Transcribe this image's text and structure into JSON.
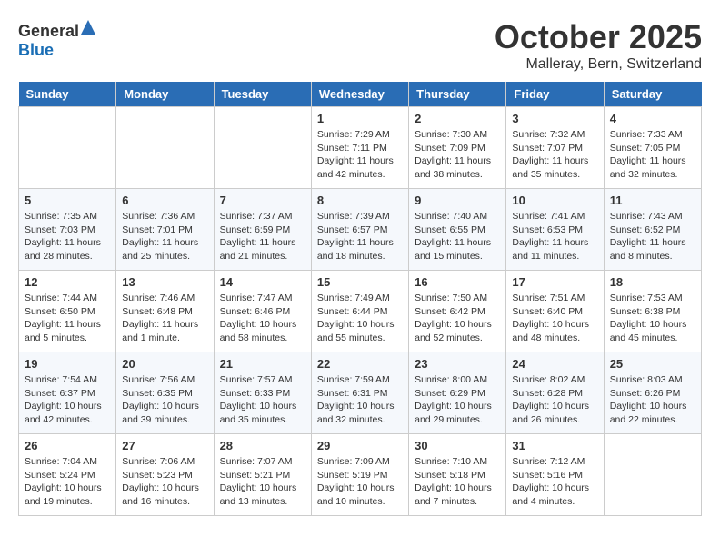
{
  "header": {
    "logo_general": "General",
    "logo_blue": "Blue",
    "month": "October 2025",
    "location": "Malleray, Bern, Switzerland"
  },
  "days_of_week": [
    "Sunday",
    "Monday",
    "Tuesday",
    "Wednesday",
    "Thursday",
    "Friday",
    "Saturday"
  ],
  "weeks": [
    [
      {
        "day": "",
        "info": ""
      },
      {
        "day": "",
        "info": ""
      },
      {
        "day": "",
        "info": ""
      },
      {
        "day": "1",
        "info": "Sunrise: 7:29 AM\nSunset: 7:11 PM\nDaylight: 11 hours\nand 42 minutes."
      },
      {
        "day": "2",
        "info": "Sunrise: 7:30 AM\nSunset: 7:09 PM\nDaylight: 11 hours\nand 38 minutes."
      },
      {
        "day": "3",
        "info": "Sunrise: 7:32 AM\nSunset: 7:07 PM\nDaylight: 11 hours\nand 35 minutes."
      },
      {
        "day": "4",
        "info": "Sunrise: 7:33 AM\nSunset: 7:05 PM\nDaylight: 11 hours\nand 32 minutes."
      }
    ],
    [
      {
        "day": "5",
        "info": "Sunrise: 7:35 AM\nSunset: 7:03 PM\nDaylight: 11 hours\nand 28 minutes."
      },
      {
        "day": "6",
        "info": "Sunrise: 7:36 AM\nSunset: 7:01 PM\nDaylight: 11 hours\nand 25 minutes."
      },
      {
        "day": "7",
        "info": "Sunrise: 7:37 AM\nSunset: 6:59 PM\nDaylight: 11 hours\nand 21 minutes."
      },
      {
        "day": "8",
        "info": "Sunrise: 7:39 AM\nSunset: 6:57 PM\nDaylight: 11 hours\nand 18 minutes."
      },
      {
        "day": "9",
        "info": "Sunrise: 7:40 AM\nSunset: 6:55 PM\nDaylight: 11 hours\nand 15 minutes."
      },
      {
        "day": "10",
        "info": "Sunrise: 7:41 AM\nSunset: 6:53 PM\nDaylight: 11 hours\nand 11 minutes."
      },
      {
        "day": "11",
        "info": "Sunrise: 7:43 AM\nSunset: 6:52 PM\nDaylight: 11 hours\nand 8 minutes."
      }
    ],
    [
      {
        "day": "12",
        "info": "Sunrise: 7:44 AM\nSunset: 6:50 PM\nDaylight: 11 hours\nand 5 minutes."
      },
      {
        "day": "13",
        "info": "Sunrise: 7:46 AM\nSunset: 6:48 PM\nDaylight: 11 hours\nand 1 minute."
      },
      {
        "day": "14",
        "info": "Sunrise: 7:47 AM\nSunset: 6:46 PM\nDaylight: 10 hours\nand 58 minutes."
      },
      {
        "day": "15",
        "info": "Sunrise: 7:49 AM\nSunset: 6:44 PM\nDaylight: 10 hours\nand 55 minutes."
      },
      {
        "day": "16",
        "info": "Sunrise: 7:50 AM\nSunset: 6:42 PM\nDaylight: 10 hours\nand 52 minutes."
      },
      {
        "day": "17",
        "info": "Sunrise: 7:51 AM\nSunset: 6:40 PM\nDaylight: 10 hours\nand 48 minutes."
      },
      {
        "day": "18",
        "info": "Sunrise: 7:53 AM\nSunset: 6:38 PM\nDaylight: 10 hours\nand 45 minutes."
      }
    ],
    [
      {
        "day": "19",
        "info": "Sunrise: 7:54 AM\nSunset: 6:37 PM\nDaylight: 10 hours\nand 42 minutes."
      },
      {
        "day": "20",
        "info": "Sunrise: 7:56 AM\nSunset: 6:35 PM\nDaylight: 10 hours\nand 39 minutes."
      },
      {
        "day": "21",
        "info": "Sunrise: 7:57 AM\nSunset: 6:33 PM\nDaylight: 10 hours\nand 35 minutes."
      },
      {
        "day": "22",
        "info": "Sunrise: 7:59 AM\nSunset: 6:31 PM\nDaylight: 10 hours\nand 32 minutes."
      },
      {
        "day": "23",
        "info": "Sunrise: 8:00 AM\nSunset: 6:29 PM\nDaylight: 10 hours\nand 29 minutes."
      },
      {
        "day": "24",
        "info": "Sunrise: 8:02 AM\nSunset: 6:28 PM\nDaylight: 10 hours\nand 26 minutes."
      },
      {
        "day": "25",
        "info": "Sunrise: 8:03 AM\nSunset: 6:26 PM\nDaylight: 10 hours\nand 22 minutes."
      }
    ],
    [
      {
        "day": "26",
        "info": "Sunrise: 7:04 AM\nSunset: 5:24 PM\nDaylight: 10 hours\nand 19 minutes."
      },
      {
        "day": "27",
        "info": "Sunrise: 7:06 AM\nSunset: 5:23 PM\nDaylight: 10 hours\nand 16 minutes."
      },
      {
        "day": "28",
        "info": "Sunrise: 7:07 AM\nSunset: 5:21 PM\nDaylight: 10 hours\nand 13 minutes."
      },
      {
        "day": "29",
        "info": "Sunrise: 7:09 AM\nSunset: 5:19 PM\nDaylight: 10 hours\nand 10 minutes."
      },
      {
        "day": "30",
        "info": "Sunrise: 7:10 AM\nSunset: 5:18 PM\nDaylight: 10 hours\nand 7 minutes."
      },
      {
        "day": "31",
        "info": "Sunrise: 7:12 AM\nSunset: 5:16 PM\nDaylight: 10 hours\nand 4 minutes."
      },
      {
        "day": "",
        "info": ""
      }
    ]
  ]
}
